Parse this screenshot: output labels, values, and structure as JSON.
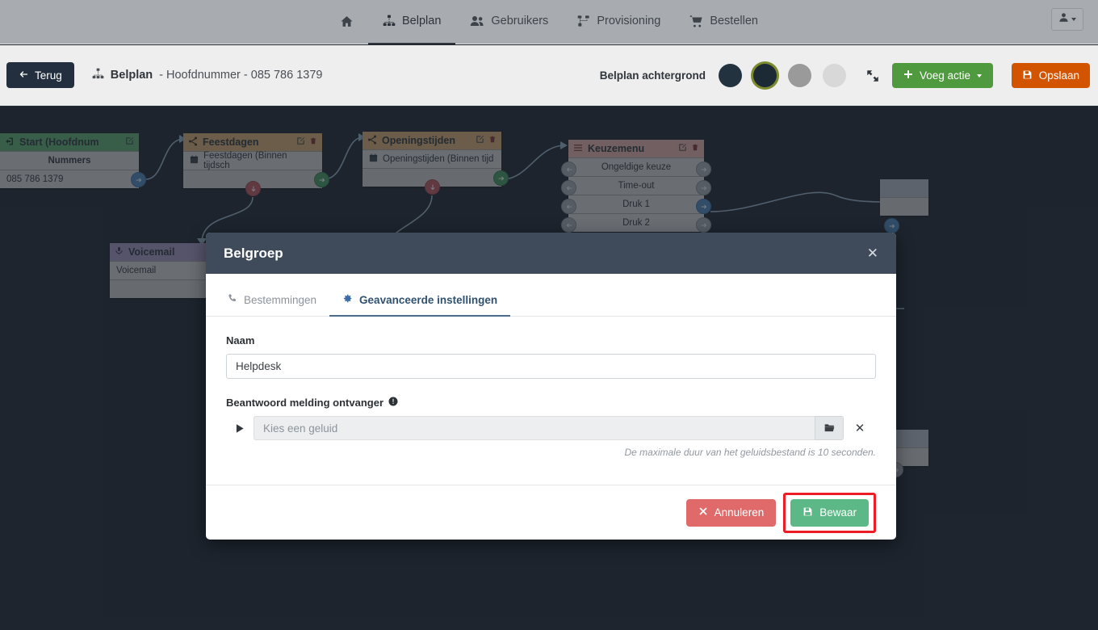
{
  "topnav": {
    "items": [
      {
        "label": "",
        "icon": "home-icon",
        "name": "nav-home",
        "active": false
      },
      {
        "label": "Belplan",
        "icon": "sitemap-icon",
        "name": "nav-belplan",
        "active": true
      },
      {
        "label": "Gebruikers",
        "icon": "users-icon",
        "name": "nav-gebruikers",
        "active": false
      },
      {
        "label": "Provisioning",
        "icon": "provisioning-icon",
        "name": "nav-provisioning",
        "active": false
      },
      {
        "label": "Bestellen",
        "icon": "cart-icon",
        "name": "nav-bestellen",
        "active": false
      }
    ],
    "account_icon": "user-icon"
  },
  "subheader": {
    "back_label": "Terug",
    "back_icon": "arrow-left-icon",
    "crumb_icon": "sitemap-icon",
    "crumb_bold": "Belplan",
    "crumb_rest": "- Hoofdnummer - 085 786 1379",
    "background_label": "Belplan achtergrond",
    "swatches": [
      {
        "color": "#22333f",
        "selected": false
      },
      {
        "color": "#1c2a35",
        "selected": true
      },
      {
        "color": "#9a9a9a",
        "selected": false
      },
      {
        "color": "#d8d8d8",
        "selected": false
      }
    ],
    "expand_icon": "expand-arrows-icon",
    "add_action_label": "Voeg actie",
    "add_action_icon": "plus-icon",
    "save_label": "Opslaan",
    "save_icon": "floppy-disk-icon",
    "add_action_color": "#4f9a3f",
    "save_color": "#d35400"
  },
  "canvas": {
    "background": "#1e252e",
    "nodes": [
      {
        "name": "node-start",
        "title": "Start (Hoofdnum",
        "header_icon": "sign-in-icon",
        "header_color": "#5aa36a",
        "actions": [
          "edit-icon"
        ],
        "rows": [
          {
            "text": "Nummers",
            "bold": true,
            "center": true
          },
          {
            "text": "085 786 1379",
            "bold": false,
            "center": false
          }
        ]
      },
      {
        "name": "node-feestdagen",
        "title": "Feestdagen",
        "header_icon": "share-alt-icon",
        "header_color": "#c9a26b",
        "actions": [
          "edit-icon",
          "trash-icon"
        ],
        "rows": [
          {
            "text": "Feestdagen (Binnen tijdsch",
            "icon": "calendar-icon"
          },
          {
            "text": "",
            "blank": true
          }
        ]
      },
      {
        "name": "node-openingstijden",
        "title": "Openingstijden",
        "header_icon": "share-alt-icon",
        "header_color": "#c9a26b",
        "actions": [
          "edit-icon",
          "trash-icon"
        ],
        "rows": [
          {
            "text": "Openingstijden (Binnen tijd",
            "icon": "calendar-icon"
          },
          {
            "text": "",
            "blank": true
          }
        ]
      },
      {
        "name": "node-keuzemenu",
        "title": "Keuzemenu",
        "header_icon": "bars-icon",
        "header_color": "#d9a79f",
        "actions": [
          "edit-icon",
          "trash-icon"
        ],
        "rows": [
          {
            "text": "Ongeldige keuze",
            "center": true
          },
          {
            "text": "Time-out",
            "center": true
          },
          {
            "text": "Druk 1",
            "center": true
          },
          {
            "text": "Druk 2",
            "center": true
          }
        ]
      },
      {
        "name": "node-voicemail",
        "title": "Voicemail",
        "header_icon": "microphone-icon",
        "header_color": "#9c8fb5",
        "actions": [],
        "rows": [
          {
            "text": "Voicemail"
          },
          {
            "text": "",
            "blank": true
          }
        ]
      }
    ]
  },
  "modal": {
    "title": "Belgroep",
    "close_icon": "close-icon",
    "tabs": [
      {
        "label": "Bestemmingen",
        "icon": "phone-icon",
        "name": "tab-bestemmingen",
        "active": false
      },
      {
        "label": "Geavanceerde instellingen",
        "icon": "gear-icon",
        "name": "tab-geavanceerde-instellingen",
        "active": true
      }
    ],
    "name_label": "Naam",
    "name_value": "Helpdesk",
    "name_placeholder": "",
    "sound_label": "Beantwoord melding ontvanger",
    "sound_info_icon": "info-circle-icon",
    "sound_play_icon": "play-icon",
    "sound_placeholder": "Kies een geluid",
    "sound_folder_icon": "folder-open-icon",
    "sound_clear_icon": "close-icon",
    "hint": "De maximale duur van het geluidsbestand is 10 seconden.",
    "cancel_label": "Annuleren",
    "cancel_icon": "times-icon",
    "save_label": "Bewaar",
    "save_icon": "floppy-disk-icon",
    "cancel_color": "#e06a6a",
    "save_color": "#5cb987",
    "highlight_color": "#ee1c25"
  }
}
